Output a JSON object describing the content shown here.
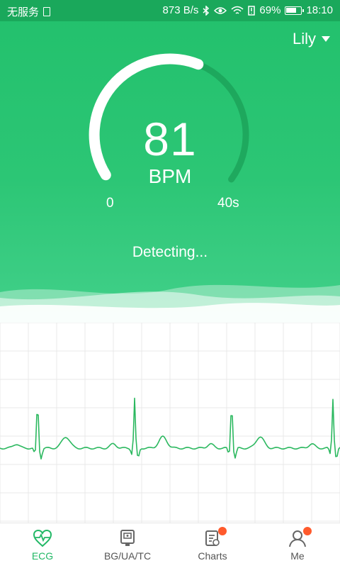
{
  "status_bar": {
    "carrier": "无服务",
    "speed": "873 B/s",
    "battery": "69%",
    "time": "18:10"
  },
  "header": {
    "user_name": "Lily"
  },
  "gauge": {
    "value": "81",
    "unit": "BPM",
    "min_label": "0",
    "max_label": "40s",
    "progress": 0.58
  },
  "status": {
    "text": "Detecting..."
  },
  "tabs": [
    {
      "label": "ECG",
      "icon": "heart-ecg-icon",
      "active": true,
      "badge": false
    },
    {
      "label": "BG/UA/TC",
      "icon": "meter-device-icon",
      "active": false,
      "badge": false
    },
    {
      "label": "Charts",
      "icon": "report-icon",
      "active": false,
      "badge": true
    },
    {
      "label": "Me",
      "icon": "person-icon",
      "active": false,
      "badge": true
    }
  ],
  "colors": {
    "primary": "#22c06c",
    "ecg_line": "#2bb85f",
    "badge": "#ff5a2c"
  }
}
